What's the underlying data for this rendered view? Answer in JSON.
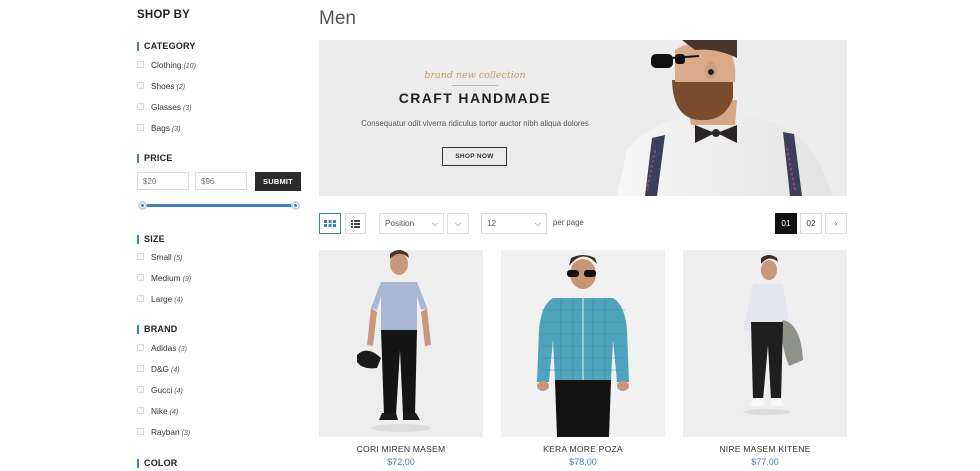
{
  "sidebar": {
    "title": "SHOP BY",
    "category": {
      "title": "CATEGORY",
      "items": [
        {
          "label": "Clothing",
          "count": "(10)"
        },
        {
          "label": "Shoes",
          "count": "(2)"
        },
        {
          "label": "Glasses",
          "count": "(3)"
        },
        {
          "label": "Bags",
          "count": "(3)"
        }
      ]
    },
    "price": {
      "title": "PRICE",
      "min_placeholder": "$20",
      "max_placeholder": "$96",
      "submit_label": "SUBMIT"
    },
    "size": {
      "title": "SIZE",
      "items": [
        {
          "label": "Small",
          "count": "(5)"
        },
        {
          "label": "Medium",
          "count": "(9)"
        },
        {
          "label": "Large",
          "count": "(4)"
        }
      ]
    },
    "brand": {
      "title": "BRAND",
      "items": [
        {
          "label": "Adidas",
          "count": "(3)"
        },
        {
          "label": "D&G",
          "count": "(4)"
        },
        {
          "label": "Gucci",
          "count": "(4)"
        },
        {
          "label": "Nike",
          "count": "(4)"
        },
        {
          "label": "Rayban",
          "count": "(3)"
        }
      ]
    },
    "color": {
      "title": "COLOR"
    }
  },
  "main": {
    "title": "Men",
    "banner": {
      "subtitle": "brand new collection",
      "title": "CRAFT HANDMADE",
      "text": "Consequatur odit viverra ridiculus tortor auctor nibh aliqua dolores",
      "button_label": "SHOP NOW"
    },
    "toolbar": {
      "sort_value": "Position",
      "limit_value": "12",
      "per_page_label": "per page",
      "pages": [
        "01",
        "02"
      ],
      "active_page": "01",
      "next_icon": "chevron-right-icon"
    },
    "products": [
      {
        "name": "CORI MIREN MASEM",
        "price": "$72.00"
      },
      {
        "name": "KERA MORE POZA",
        "price": "$78.00"
      },
      {
        "name": "NIRE MASEM KITENE",
        "price": "$77.00"
      }
    ]
  },
  "colors": {
    "accent": "#3a82c4",
    "dark": "#2d2d2d",
    "banner_bg": "#ececec",
    "banner_subtitle": "#c69a6b"
  }
}
